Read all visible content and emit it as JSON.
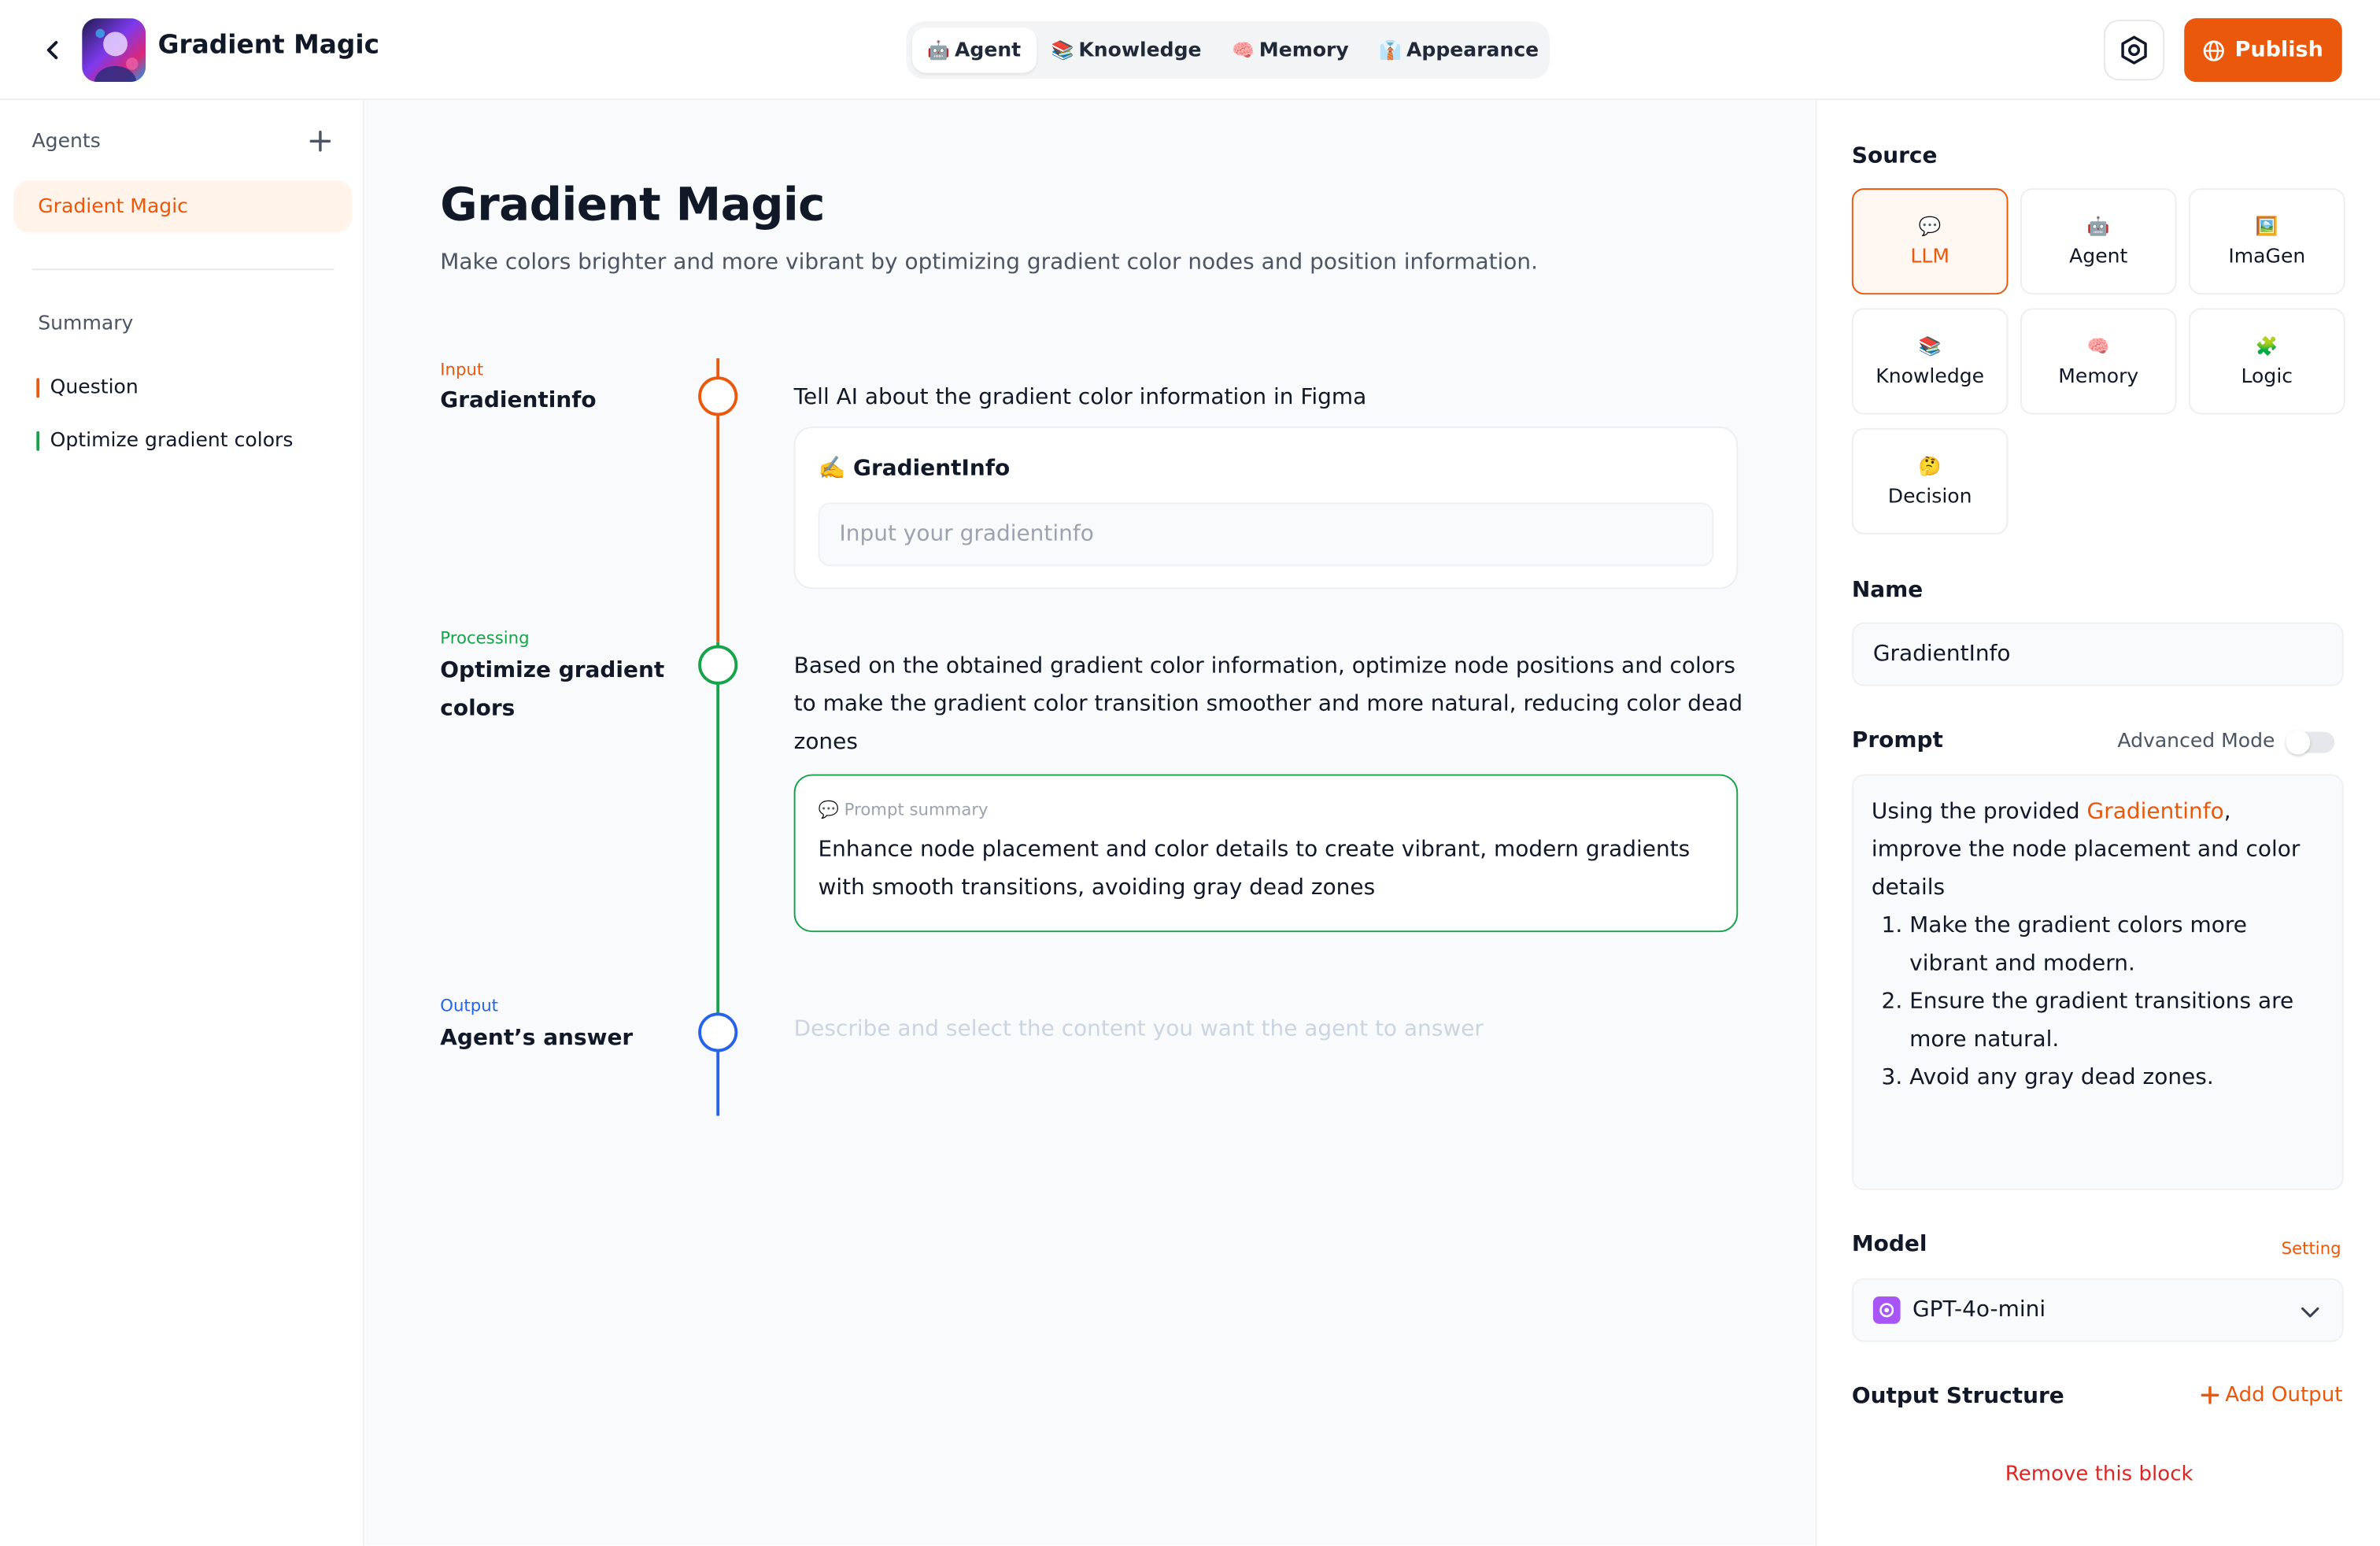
{
  "header": {
    "title": "Gradient Magic",
    "tabs": [
      {
        "label": "Agent",
        "emoji": "🤖"
      },
      {
        "label": "Knowledge",
        "emoji": "📚"
      },
      {
        "label": "Memory",
        "emoji": "🧠"
      },
      {
        "label": "Appearance",
        "emoji": "👔"
      }
    ],
    "publish_label": "Publish"
  },
  "sidebar": {
    "agents_label": "Agents",
    "agent_item": "Gradient Magic",
    "summary_label": "Summary",
    "summary_items": [
      {
        "label": "Question",
        "color": "#ea580c"
      },
      {
        "label": "Optimize gradient colors",
        "color": "#16a34a"
      }
    ]
  },
  "main": {
    "title": "Gradient Magic",
    "description": "Make colors brighter and more vibrant by optimizing gradient color nodes and position information.",
    "steps": [
      {
        "tag": "Input",
        "tag_color": "#ea580c",
        "name": "Gradientinfo",
        "text": "Tell AI about the gradient color information in Figma",
        "card_label": "✍️ GradientInfo",
        "card_placeholder": "Input your gradientinfo"
      },
      {
        "tag": "Processing",
        "tag_color": "#16a34a",
        "name": "Optimize gradient colors",
        "text": "Based on the obtained gradient color information, optimize node positions and colors to make the gradient color transition smoother and more natural, reducing color dead zones",
        "card_label": "💬 Prompt summary",
        "card_text": "Enhance node placement and color details to create vibrant, modern gradients with smooth transitions, avoiding gray dead zones"
      },
      {
        "tag": "Output",
        "tag_color": "#2563eb",
        "name": "Agent’s answer",
        "placeholder": "Describe and select the content you want the agent to answer"
      }
    ]
  },
  "right_panel": {
    "source_label": "Source",
    "sources": [
      {
        "label": "LLM",
        "emoji": "💬",
        "active": true
      },
      {
        "label": "Agent",
        "emoji": "🤖"
      },
      {
        "label": "ImaGen",
        "emoji": "🖼️"
      },
      {
        "label": "Knowledge",
        "emoji": "📚"
      },
      {
        "label": "Memory",
        "emoji": "🧠"
      },
      {
        "label": "Logic",
        "emoji": "🧩"
      },
      {
        "label": "Decision",
        "emoji": "🤔"
      }
    ],
    "name_label": "Name",
    "name_value": "GradientInfo",
    "prompt_label": "Prompt",
    "advanced_mode_label": "Advanced Mode",
    "prompt": {
      "intro_before": "Using the provided ",
      "intro_highlight": "Gradientinfo",
      "intro_after": ", improve the node placement and color details",
      "items": [
        "Make the gradient colors more vibrant and modern.",
        "Ensure the gradient transitions are more natural.",
        "Avoid any gray dead zones."
      ]
    },
    "model_label": "Model",
    "setting_label": "Setting",
    "model_value": "GPT-4o-mini",
    "output_structure_label": "Output Structure",
    "add_output_label": "Add Output",
    "remove_block_label": "Remove this block"
  }
}
